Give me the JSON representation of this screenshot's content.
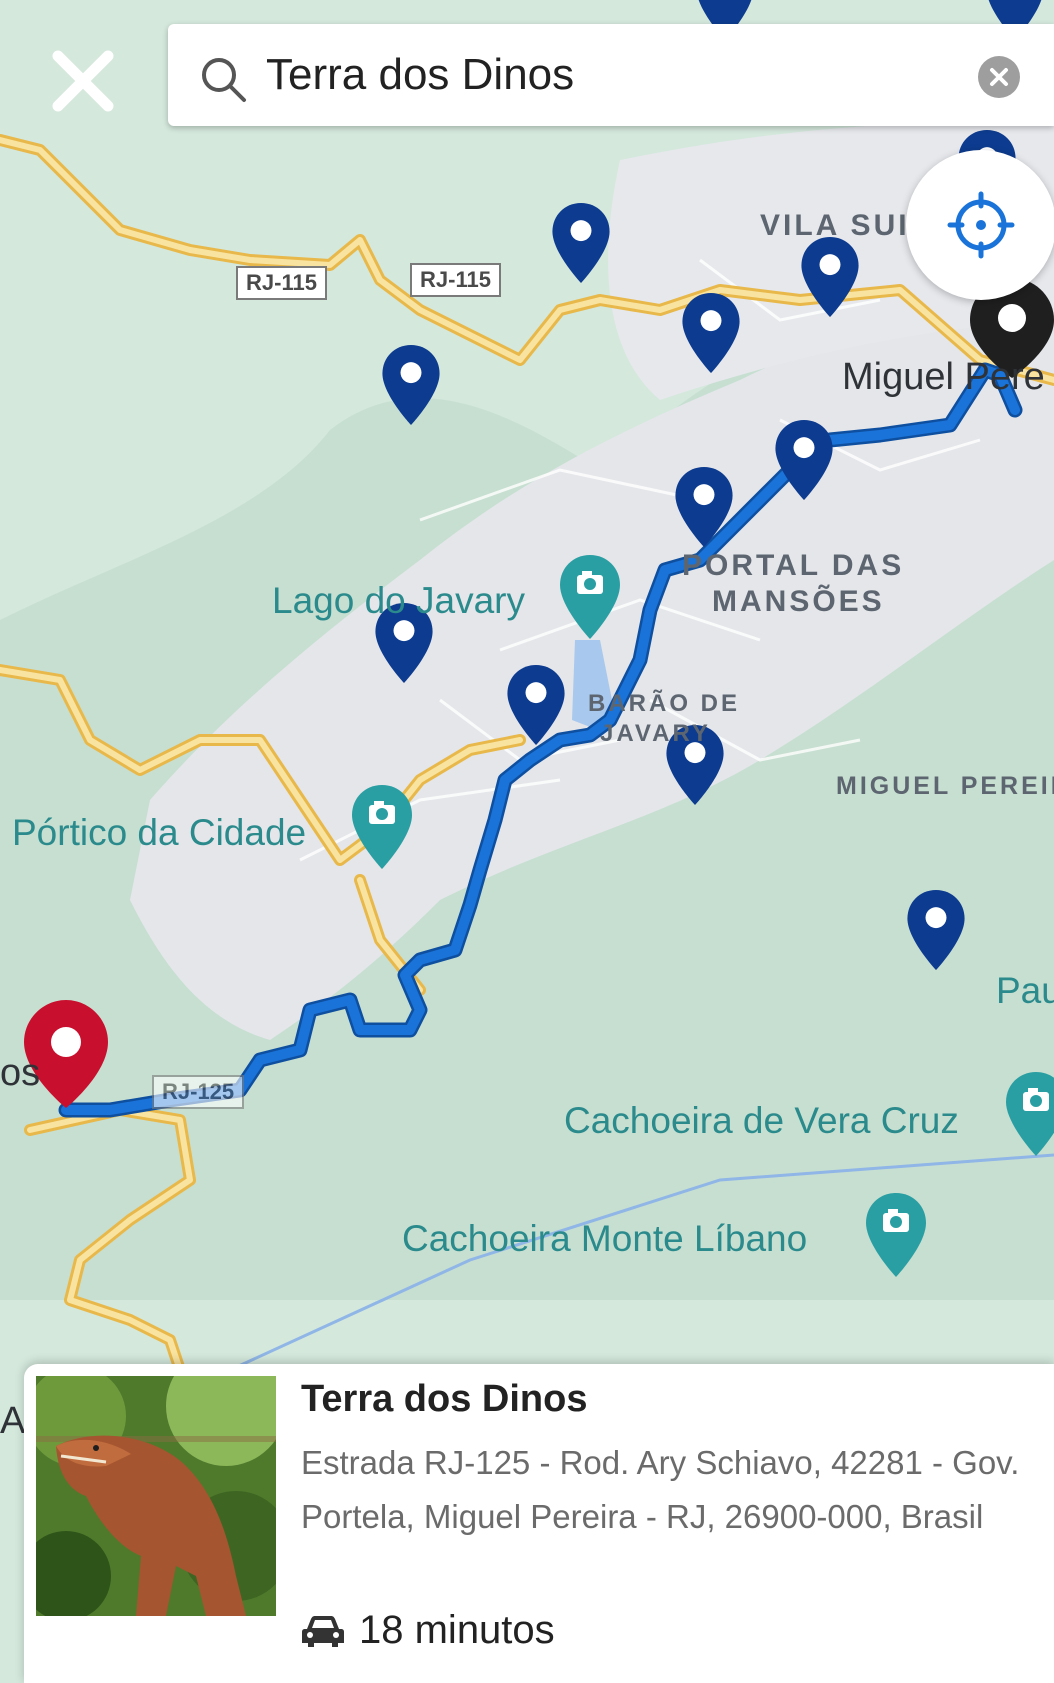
{
  "search": {
    "value": "Terra dos Dinos",
    "placeholder": ""
  },
  "map": {
    "road_shields": [
      "RJ-115",
      "RJ-115",
      "RJ-125"
    ],
    "poi_labels": [
      "Lago do Javary",
      "Pórtico da Cidade",
      "Cachoeira de Vera Cruz",
      "Cachoeira Monte Líbano"
    ],
    "area_labels": {
      "vila_suica": "VILA SUIS",
      "portal_line1": "PORTAL DAS",
      "portal_line2": "MANSÕES",
      "barao_line1": "BARÃO DE",
      "barao_line2": "JAVARY",
      "miguel_district": "MIGUEL PEREIR"
    },
    "city_labels": {
      "miguel": "Miguel Pere",
      "pau": "Pau",
      "os": "os",
      "ar": "Ar"
    }
  },
  "place": {
    "name": "Terra dos Dinos",
    "address": "Estrada RJ-125 - Rod. Ary Schiavo, 42281 - Gov. Portela, Miguel Pereira - RJ, 26900-000, Brasil",
    "eta": "18 minutos"
  },
  "colors": {
    "route": "#1565c0",
    "marker": "#0d3b8f",
    "destination_marker": "#c8102e",
    "user_marker": "#1f1f1f",
    "poi_teal": "#2a8a8c",
    "road_yellow": "#f5cf63"
  },
  "icons": [
    "close-icon",
    "search-icon",
    "clear-icon",
    "locate-icon",
    "car-icon",
    "camera-icon",
    "map-pin-icon"
  ]
}
